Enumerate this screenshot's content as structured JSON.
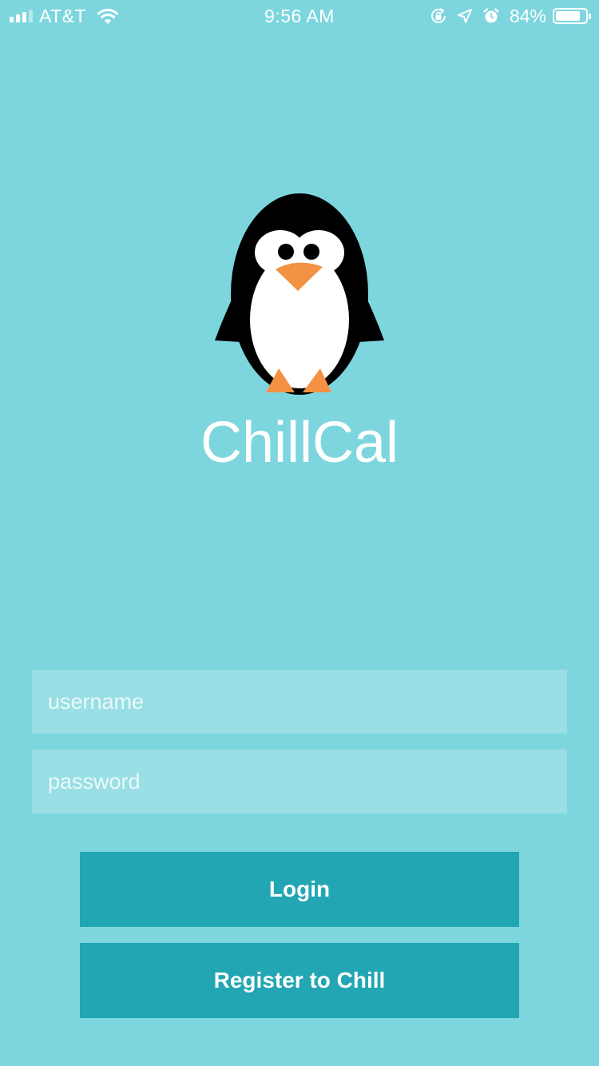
{
  "status_bar": {
    "carrier": "AT&T",
    "time": "9:56 AM",
    "battery_percent": "84%",
    "battery_level": 0.84,
    "icons": [
      "signal-icon",
      "wifi-icon",
      "orientation-lock-icon",
      "location-icon",
      "alarm-icon",
      "battery-icon"
    ]
  },
  "app": {
    "title": "ChillCal",
    "logo": "penguin-logo"
  },
  "login_form": {
    "username_placeholder": "username",
    "username_value": "",
    "password_placeholder": "password",
    "password_value": "",
    "login_label": "Login",
    "register_label": "Register to Chill"
  },
  "colors": {
    "background": "#7dd6de",
    "button": "#22a6b3",
    "beak_feet": "#f39242",
    "text": "#ffffff"
  }
}
